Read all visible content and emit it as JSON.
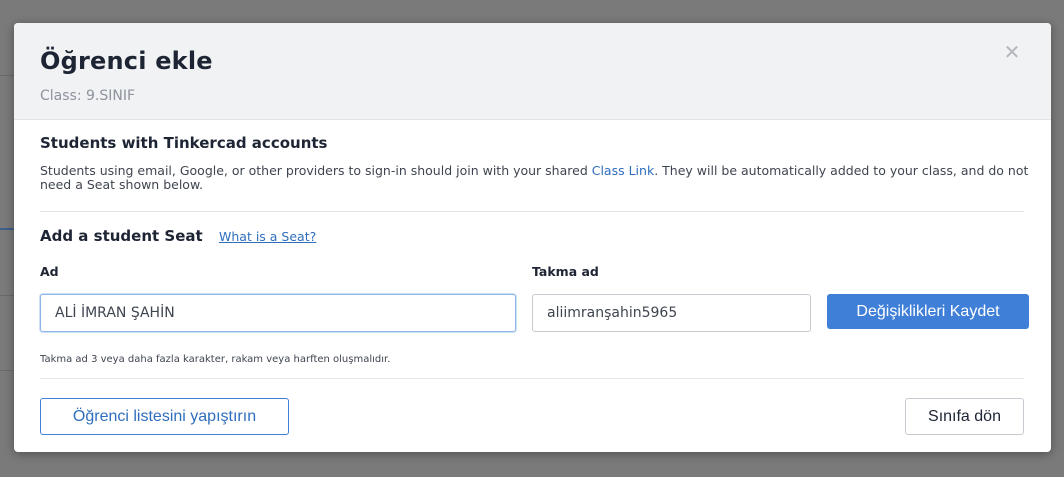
{
  "modal": {
    "title": "Öğrenci ekle",
    "subtitle": "Class: 9.SINIF",
    "close_icon": "close-icon",
    "accounts_section": {
      "title": "Students with Tinkercad accounts",
      "desc_before_link": "Students using email, Google, or other providers to sign-in should join with your shared ",
      "link_label": "Class Link",
      "desc_after_link": ". They will be automatically added to your class, and do not need a Seat shown below."
    },
    "seat_section": {
      "title": "Add a student Seat",
      "help_link": "What is a Seat?",
      "name_label": "Ad",
      "name_value": "ALİ İMRAN ŞAHİN",
      "nickname_label": "Takma ad",
      "nickname_value": "aliimranşahin5965",
      "save_button": "Değişiklikleri Kaydet",
      "hint": "Takma ad 3 veya daha fazla karakter, rakam veya harften oluşmalıdır."
    },
    "footer": {
      "paste_list_button": "Öğrenci listesini yapıştırın",
      "back_button": "Sınıfa dön"
    }
  },
  "colors": {
    "accent": "#3f7fd8",
    "link": "#2f6ebd",
    "overlay": "#7a7a7a"
  }
}
